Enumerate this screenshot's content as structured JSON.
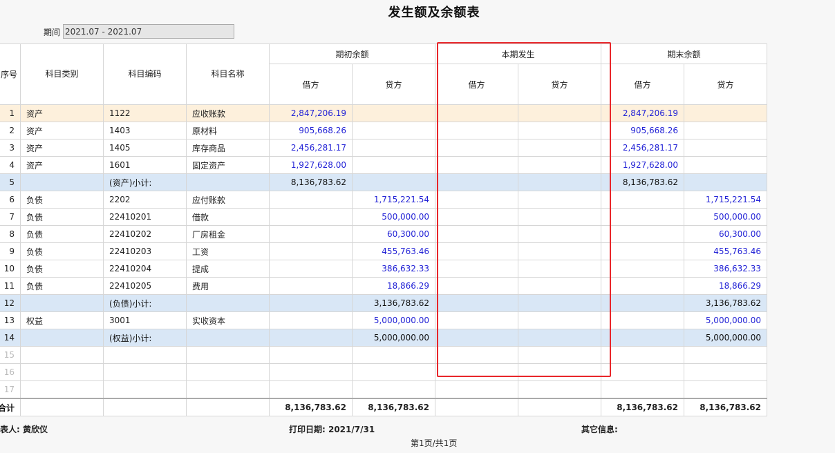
{
  "title": "发生额及余额表",
  "period": {
    "label": "期间",
    "value": "2021.07 - 2021.07"
  },
  "headers": {
    "seq": "序号",
    "category": "科目类别",
    "code": "科目编码",
    "name": "科目名称",
    "opening": "期初余额",
    "current": "本期发生",
    "ending": "期末余额",
    "debit": "借方",
    "credit": "贷方"
  },
  "rows": [
    {
      "seq": "1",
      "category": "资产",
      "code": "1122",
      "name": "应收账款",
      "open_debit": "2,847,206.19",
      "open_credit": "",
      "cur_debit": "",
      "cur_credit": "",
      "end_debit": "2,847,206.19",
      "end_credit": ""
    },
    {
      "seq": "2",
      "category": "资产",
      "code": "1403",
      "name": "原材料",
      "open_debit": "905,668.26",
      "open_credit": "",
      "cur_debit": "",
      "cur_credit": "",
      "end_debit": "905,668.26",
      "end_credit": ""
    },
    {
      "seq": "3",
      "category": "资产",
      "code": "1405",
      "name": "库存商品",
      "open_debit": "2,456,281.17",
      "open_credit": "",
      "cur_debit": "",
      "cur_credit": "",
      "end_debit": "2,456,281.17",
      "end_credit": ""
    },
    {
      "seq": "4",
      "category": "资产",
      "code": "1601",
      "name": "固定资产",
      "open_debit": "1,927,628.00",
      "open_credit": "",
      "cur_debit": "",
      "cur_credit": "",
      "end_debit": "1,927,628.00",
      "end_credit": ""
    },
    {
      "seq": "5",
      "category": "",
      "code": "(资产)小计:",
      "name": "",
      "open_debit": "8,136,783.62",
      "open_credit": "",
      "cur_debit": "",
      "cur_credit": "",
      "end_debit": "8,136,783.62",
      "end_credit": ""
    },
    {
      "seq": "6",
      "category": "负债",
      "code": "2202",
      "name": "应付账款",
      "open_debit": "",
      "open_credit": "1,715,221.54",
      "cur_debit": "",
      "cur_credit": "",
      "end_debit": "",
      "end_credit": "1,715,221.54"
    },
    {
      "seq": "7",
      "category": "负债",
      "code": "22410201",
      "name": "借款",
      "open_debit": "",
      "open_credit": "500,000.00",
      "cur_debit": "",
      "cur_credit": "",
      "end_debit": "",
      "end_credit": "500,000.00"
    },
    {
      "seq": "8",
      "category": "负债",
      "code": "22410202",
      "name": "厂房租金",
      "open_debit": "",
      "open_credit": "60,300.00",
      "cur_debit": "",
      "cur_credit": "",
      "end_debit": "",
      "end_credit": "60,300.00"
    },
    {
      "seq": "9",
      "category": "负债",
      "code": "22410203",
      "name": "工资",
      "open_debit": "",
      "open_credit": "455,763.46",
      "cur_debit": "",
      "cur_credit": "",
      "end_debit": "",
      "end_credit": "455,763.46"
    },
    {
      "seq": "10",
      "category": "负债",
      "code": "22410204",
      "name": "提成",
      "open_debit": "",
      "open_credit": "386,632.33",
      "cur_debit": "",
      "cur_credit": "",
      "end_debit": "",
      "end_credit": "386,632.33"
    },
    {
      "seq": "11",
      "category": "负债",
      "code": "22410205",
      "name": "费用",
      "open_debit": "",
      "open_credit": "18,866.29",
      "cur_debit": "",
      "cur_credit": "",
      "end_debit": "",
      "end_credit": "18,866.29"
    },
    {
      "seq": "12",
      "category": "",
      "code": "(负债)小计:",
      "name": "",
      "open_debit": "",
      "open_credit": "3,136,783.62",
      "cur_debit": "",
      "cur_credit": "",
      "end_debit": "",
      "end_credit": "3,136,783.62"
    },
    {
      "seq": "13",
      "category": "权益",
      "code": "3001",
      "name": "实收资本",
      "open_debit": "",
      "open_credit": "5,000,000.00",
      "cur_debit": "",
      "cur_credit": "",
      "end_debit": "",
      "end_credit": "5,000,000.00"
    },
    {
      "seq": "14",
      "category": "",
      "code": "(权益)小计:",
      "name": "",
      "open_debit": "",
      "open_credit": "5,000,000.00",
      "cur_debit": "",
      "cur_credit": "",
      "end_debit": "",
      "end_credit": "5,000,000.00"
    },
    {
      "seq": "15",
      "category": "",
      "code": "",
      "name": "",
      "open_debit": "",
      "open_credit": "",
      "cur_debit": "",
      "cur_credit": "",
      "end_debit": "",
      "end_credit": ""
    },
    {
      "seq": "16",
      "category": "",
      "code": "",
      "name": "",
      "open_debit": "",
      "open_credit": "",
      "cur_debit": "",
      "cur_credit": "",
      "end_debit": "",
      "end_credit": ""
    },
    {
      "seq": "17",
      "category": "",
      "code": "",
      "name": "",
      "open_debit": "",
      "open_credit": "",
      "cur_debit": "",
      "cur_credit": "",
      "end_debit": "",
      "end_credit": ""
    }
  ],
  "total": {
    "label": "合计",
    "open_debit": "8,136,783.62",
    "open_credit": "8,136,783.62",
    "cur_debit": "",
    "cur_credit": "",
    "end_debit": "8,136,783.62",
    "end_credit": "8,136,783.62"
  },
  "footer": {
    "preparer": "制表人:  黄欣仪",
    "print_date": "打印日期:  2021/7/31",
    "other_info": "其它信息:",
    "page": "第1页/共1页"
  },
  "colors": {
    "highlight_row": "#fdf0dc",
    "subtotal_row": "#d9e7f6",
    "amount_blue": "#2323d6",
    "annotation_box": "#e8262a"
  }
}
